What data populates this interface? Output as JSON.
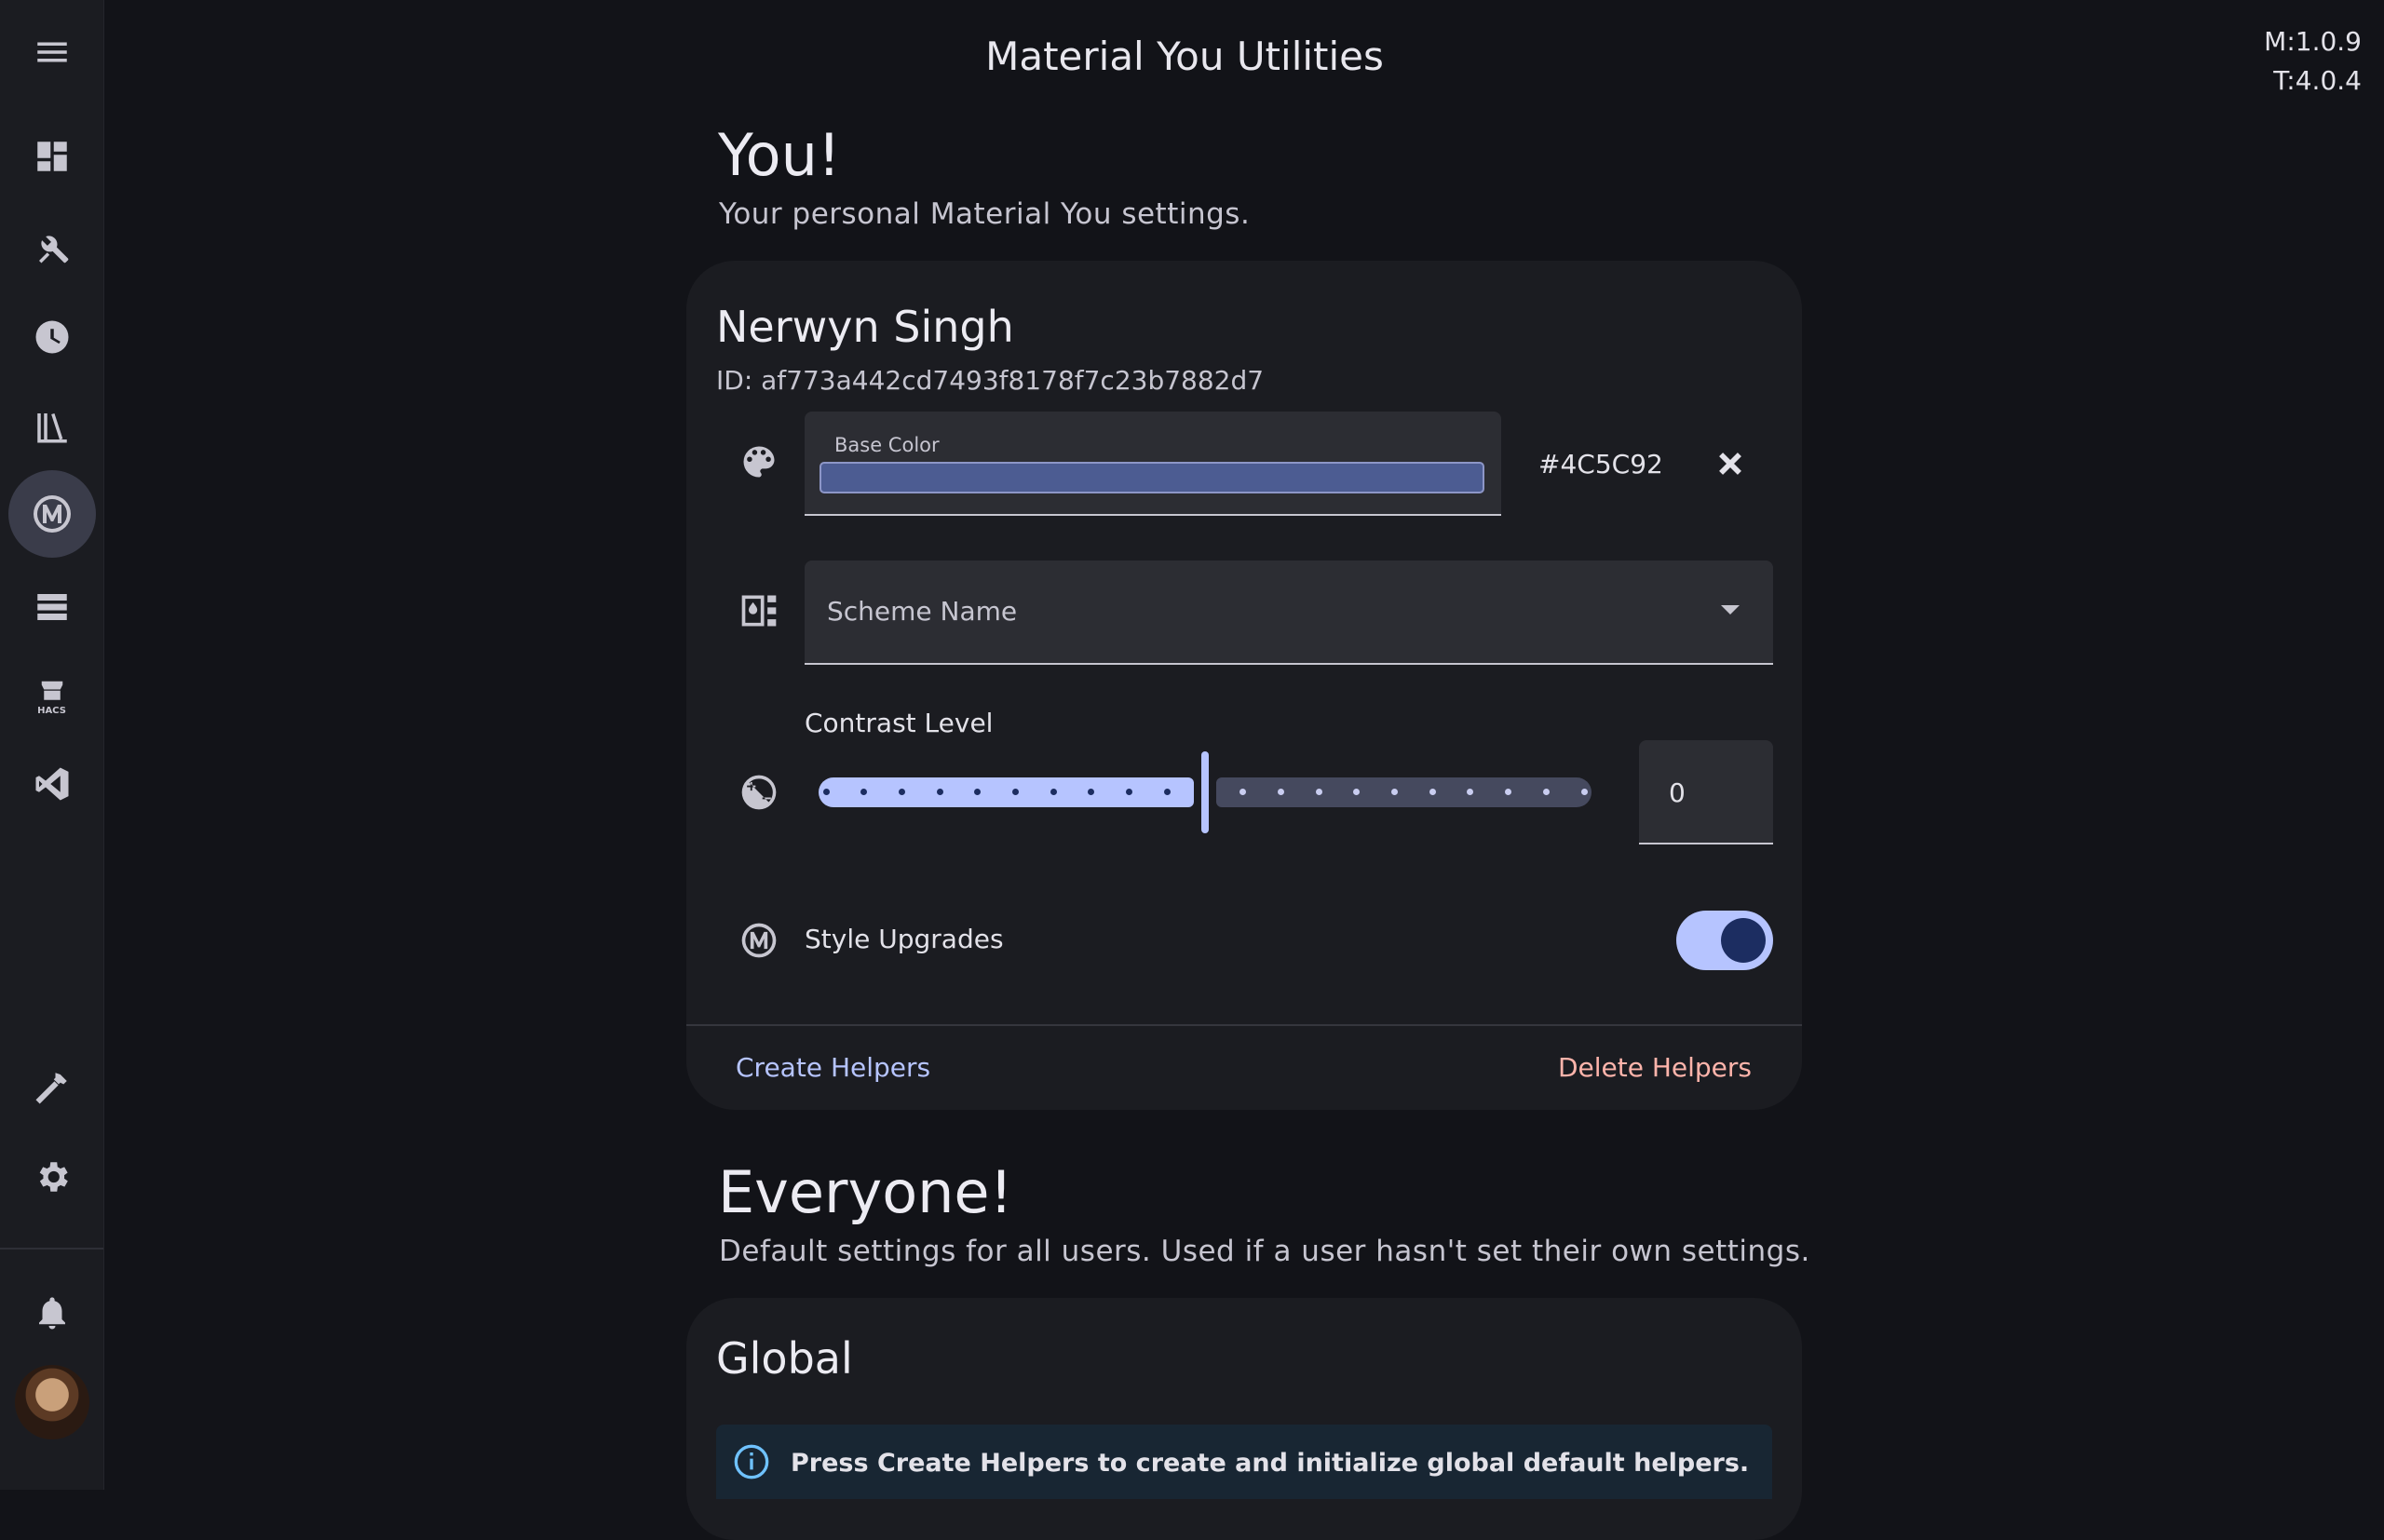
{
  "header": {
    "title": "Material You Utilities",
    "version_m": "M:1.0.9",
    "version_t": "T:4.0.4"
  },
  "sidebar": {
    "items": [
      {
        "icon": "menu-icon"
      },
      {
        "icon": "dashboard-icon"
      },
      {
        "icon": "tools-icon"
      },
      {
        "icon": "history-icon"
      },
      {
        "icon": "library-icon"
      },
      {
        "icon": "material-you-icon",
        "active": true
      },
      {
        "icon": "server-icon"
      },
      {
        "icon": "hacs-icon",
        "label": "HACS"
      },
      {
        "icon": "vscode-icon"
      },
      {
        "icon": "hammer-icon"
      },
      {
        "icon": "gear-icon"
      },
      {
        "icon": "bell-icon"
      },
      {
        "icon": "avatar"
      }
    ]
  },
  "you": {
    "title": "You!",
    "subtitle": "Your personal Material You settings.",
    "user_name": "Nerwyn Singh",
    "user_id": "ID: af773a442cd7493f8178f7c23b7882d7",
    "base_color_label": "Base Color",
    "base_color_value": "#4C5C92",
    "scheme_placeholder": "Scheme Name",
    "contrast_label": "Contrast Level",
    "contrast_value": "0",
    "contrast_fraction": 0.5,
    "style_upgrades_label": "Style Upgrades",
    "style_upgrades_on": true,
    "create_helpers": "Create Helpers",
    "delete_helpers": "Delete Helpers"
  },
  "everyone": {
    "title": "Everyone!",
    "subtitle": "Default settings for all users. Used if a user hasn't set their own settings.",
    "global_title": "Global",
    "info_text": "Press Create Helpers to create and initialize global default helpers."
  },
  "colors": {
    "accent": "#b6c4ff",
    "base_color": "#4c5c92",
    "delete": "#ffb4ab",
    "background": "#121318"
  }
}
